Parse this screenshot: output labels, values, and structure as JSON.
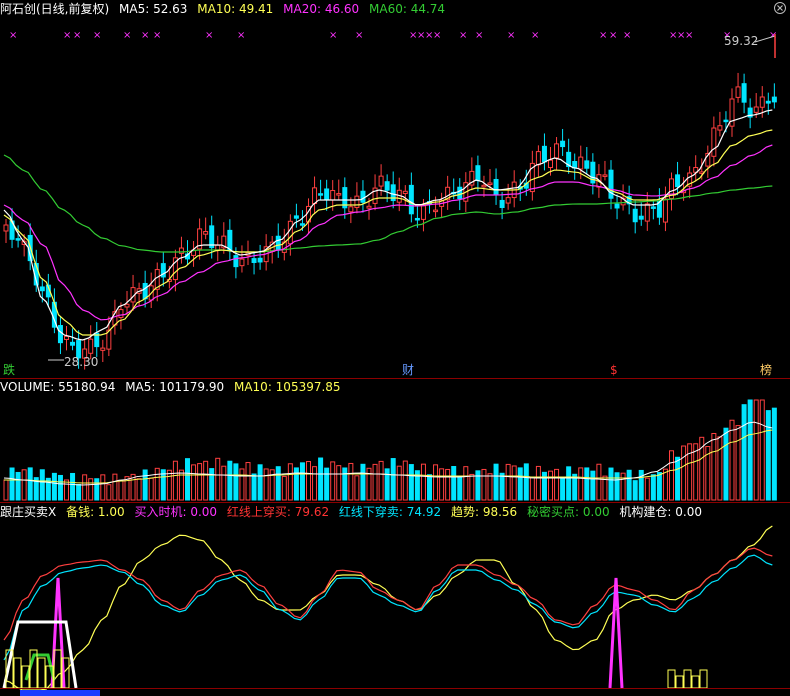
{
  "main_header": {
    "title": "阿石创(日线,前复权)",
    "ma5": "MA5: 52.63",
    "ma10": "MA10: 49.41",
    "ma20": "MA20: 46.60",
    "ma60": "MA60: 44.74"
  },
  "high_label": "59.32",
  "low_label": "28.30",
  "event_markers": {
    "left": "跌",
    "mid": "财",
    "dollar": "$",
    "right": "榜"
  },
  "volume_header": {
    "volume": "VOLUME: 55180.94",
    "ma5": "MA5: 101179.90",
    "ma10": "MA10: 105397.85"
  },
  "indicator_header": {
    "name": "跟庄买卖X",
    "backup": "备钱: 1.00",
    "buy_time": "买入时机: 0.00",
    "red_cross_up": "红线上穿买: 79.62",
    "red_cross_down": "红线下穿卖: 74.92",
    "trend": "趋势: 98.56",
    "secret_buy": "秘密买点: 0.00",
    "inst_build": "机构建仓: 0.00"
  },
  "colors": {
    "up": "#ff4040",
    "down": "#00e5ff",
    "ma5": "#ffffff",
    "ma10": "#ffff55",
    "ma20": "#ff33ff",
    "ma60": "#33cc33",
    "panel_border": "#8b0000"
  },
  "icons": {
    "close": "close-icon"
  }
}
